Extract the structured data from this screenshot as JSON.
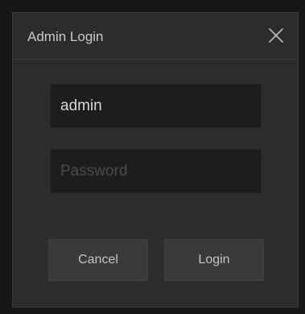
{
  "dialog": {
    "title": "Admin Login",
    "close_icon": "close-icon",
    "username": {
      "value": "admin",
      "placeholder": ""
    },
    "password": {
      "value": "",
      "placeholder": "Password"
    },
    "cancel_label": "Cancel",
    "login_label": "Login"
  },
  "colors": {
    "dialog_bg": "#2c2c2c",
    "field_bg": "#1d1d1d",
    "button_bg": "#3a3a3a",
    "text": "#c9c9c9"
  }
}
